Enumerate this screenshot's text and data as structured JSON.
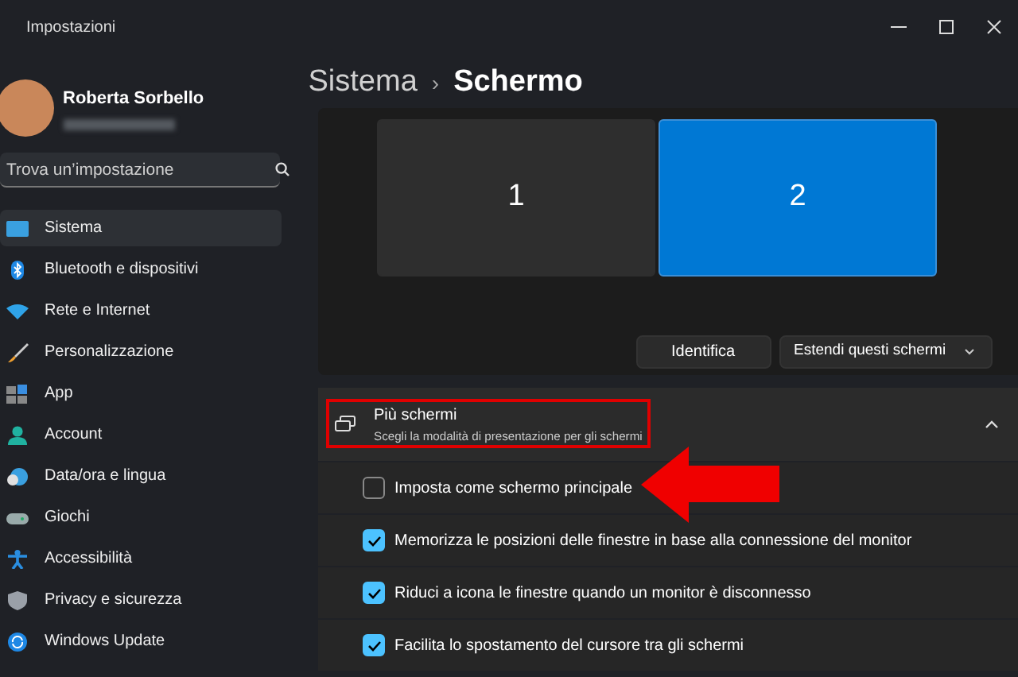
{
  "window": {
    "title": "Impostazioni"
  },
  "user": {
    "name": "Roberta Sorbello"
  },
  "search": {
    "placeholder": "Trova un’impostazione"
  },
  "sidebar": {
    "items": [
      {
        "label": "Sistema",
        "selected": true
      },
      {
        "label": "Bluetooth e dispositivi",
        "selected": false
      },
      {
        "label": "Rete e Internet",
        "selected": false
      },
      {
        "label": "Personalizzazione",
        "selected": false
      },
      {
        "label": "App",
        "selected": false
      },
      {
        "label": "Account",
        "selected": false
      },
      {
        "label": "Data/ora e lingua",
        "selected": false
      },
      {
        "label": "Giochi",
        "selected": false
      },
      {
        "label": "Accessibilità",
        "selected": false
      },
      {
        "label": "Privacy e sicurezza",
        "selected": false
      },
      {
        "label": "Windows Update",
        "selected": false
      }
    ]
  },
  "breadcrumb": {
    "parent": "Sistema",
    "separator": "›",
    "current": "Schermo"
  },
  "monitors": [
    {
      "label": "1",
      "selected": false
    },
    {
      "label": "2",
      "selected": true
    }
  ],
  "identify_button": "Identifica",
  "mode_dropdown": {
    "value": "Estendi questi schermi"
  },
  "section": {
    "title": "Più schermi",
    "subtitle": "Scegli la modalità di presentazione per gli schermi",
    "expanded": true,
    "options": [
      {
        "label": "Imposta come schermo principale",
        "checked": false
      },
      {
        "label": "Memorizza le posizioni delle finestre in base alla connessione del monitor",
        "checked": true
      },
      {
        "label": "Riduci a icona le finestre quando un monitor è disconnesso",
        "checked": true
      },
      {
        "label": "Facilita lo spostamento del cursore tra gli schermi",
        "checked": true
      }
    ]
  }
}
